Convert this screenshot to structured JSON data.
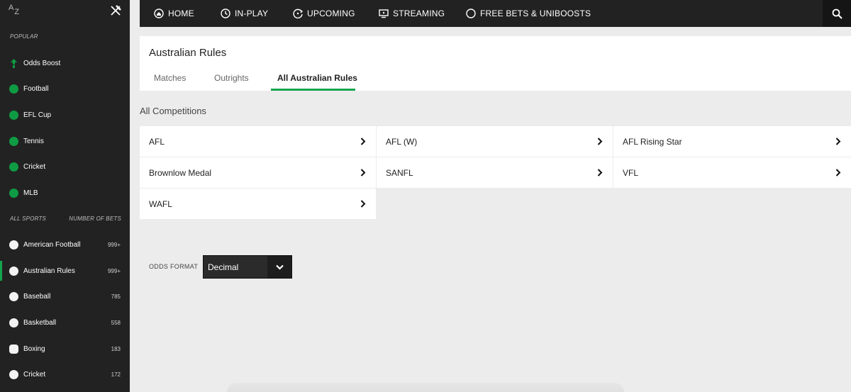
{
  "sidebar": {
    "az_top": "A",
    "az_bottom": "Z",
    "popular_heading": "POPULAR",
    "popular": [
      {
        "label": "Odds Boost",
        "icon": "odds-boost-icon"
      },
      {
        "label": "Football",
        "icon": "football-icon"
      },
      {
        "label": "EFL Cup",
        "icon": "football-icon"
      },
      {
        "label": "Tennis",
        "icon": "tennis-icon"
      },
      {
        "label": "Cricket",
        "icon": "cricket-icon"
      },
      {
        "label": "MLB",
        "icon": "baseball-icon"
      }
    ],
    "all_sports_heading": "ALL SPORTS",
    "number_of_bets_heading": "NUMBER OF BETS",
    "sports": [
      {
        "label": "American Football",
        "count": "999+",
        "icon": "american-football-icon"
      },
      {
        "label": "Australian Rules",
        "count": "999+",
        "icon": "australian-rules-icon",
        "active": true
      },
      {
        "label": "Baseball",
        "count": "785",
        "icon": "baseball-icon"
      },
      {
        "label": "Basketball",
        "count": "558",
        "icon": "basketball-icon"
      },
      {
        "label": "Boxing",
        "count": "183",
        "icon": "boxing-glove-icon"
      },
      {
        "label": "Cricket",
        "count": "172",
        "icon": "cricket-icon"
      }
    ]
  },
  "nav": {
    "items": [
      {
        "label": "HOME",
        "icon": "home-icon"
      },
      {
        "label": "IN-PLAY",
        "icon": "clock-icon"
      },
      {
        "label": "UPCOMING",
        "icon": "upcoming-icon"
      },
      {
        "label": "STREAMING",
        "icon": "monitor-icon"
      },
      {
        "label": "FREE BETS & UNIBOOSTS",
        "icon": "circle-icon"
      }
    ],
    "search_icon": "search-icon"
  },
  "page": {
    "title": "Australian Rules",
    "tabs": [
      "Matches",
      "Outrights",
      "All Australian Rules"
    ],
    "active_tab": "All Australian Rules",
    "section_heading": "All Competitions"
  },
  "competitions": [
    "AFL",
    "AFL (W)",
    "AFL Rising Star",
    "Brownlow Medal",
    "SANFL",
    "VFL",
    "WAFL"
  ],
  "odds_format": {
    "label": "ODDS FORMAT",
    "value": "Decimal"
  },
  "colors": {
    "accent": "#14a44d",
    "sidebar_bg": "#222222",
    "page_bg": "#ececec"
  }
}
